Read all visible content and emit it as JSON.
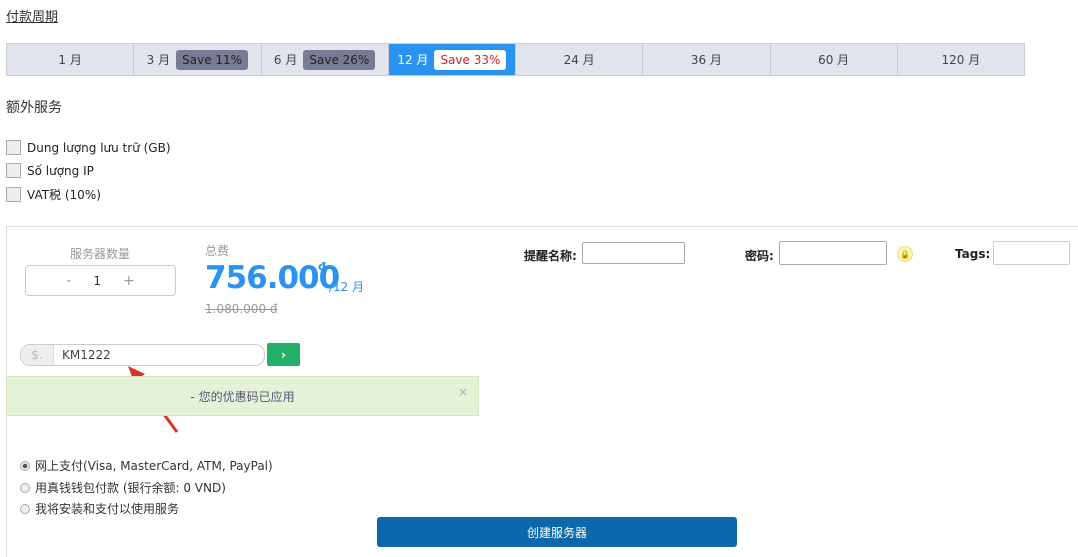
{
  "billing": {
    "title": "付款周期",
    "tabs": [
      {
        "label": "1 月"
      },
      {
        "label": "3 月",
        "badge": "Save 11%"
      },
      {
        "label": "6 月",
        "badge": "Save 26%"
      },
      {
        "label": "12 月",
        "badge": "Save 33%",
        "active": true
      },
      {
        "label": "24 月"
      },
      {
        "label": "36 月"
      },
      {
        "label": "60 月"
      },
      {
        "label": "120 月"
      }
    ]
  },
  "extras": {
    "title": "额外服务",
    "items": [
      "Dung lượng lưu trữ (GB)",
      "Số lượng IP",
      "VAT税 (10%)"
    ]
  },
  "order": {
    "qty_label": "服务器数量",
    "qty": "1",
    "minus": "-",
    "plus": "+",
    "total_label": "总费",
    "price": "756.000",
    "currency": "đ",
    "period": "/12 月",
    "old_price": "1.080.000 đ",
    "reminder_label": "提醒名称:",
    "password_label": "密码:",
    "tags_label": "Tags:"
  },
  "coupon": {
    "prefix": "$.",
    "value": "KM1222",
    "go": "›",
    "alert": "- 您的优惠码已应用",
    "close": "×"
  },
  "payment": {
    "options": [
      "网上支付(Visa, MasterCard, ATM, PayPal)",
      "用真钱钱包付款 (银行余额: 0 VND)",
      "我将安装和支付以使用服务"
    ],
    "selected": 0
  },
  "create_button": "创建服务器"
}
